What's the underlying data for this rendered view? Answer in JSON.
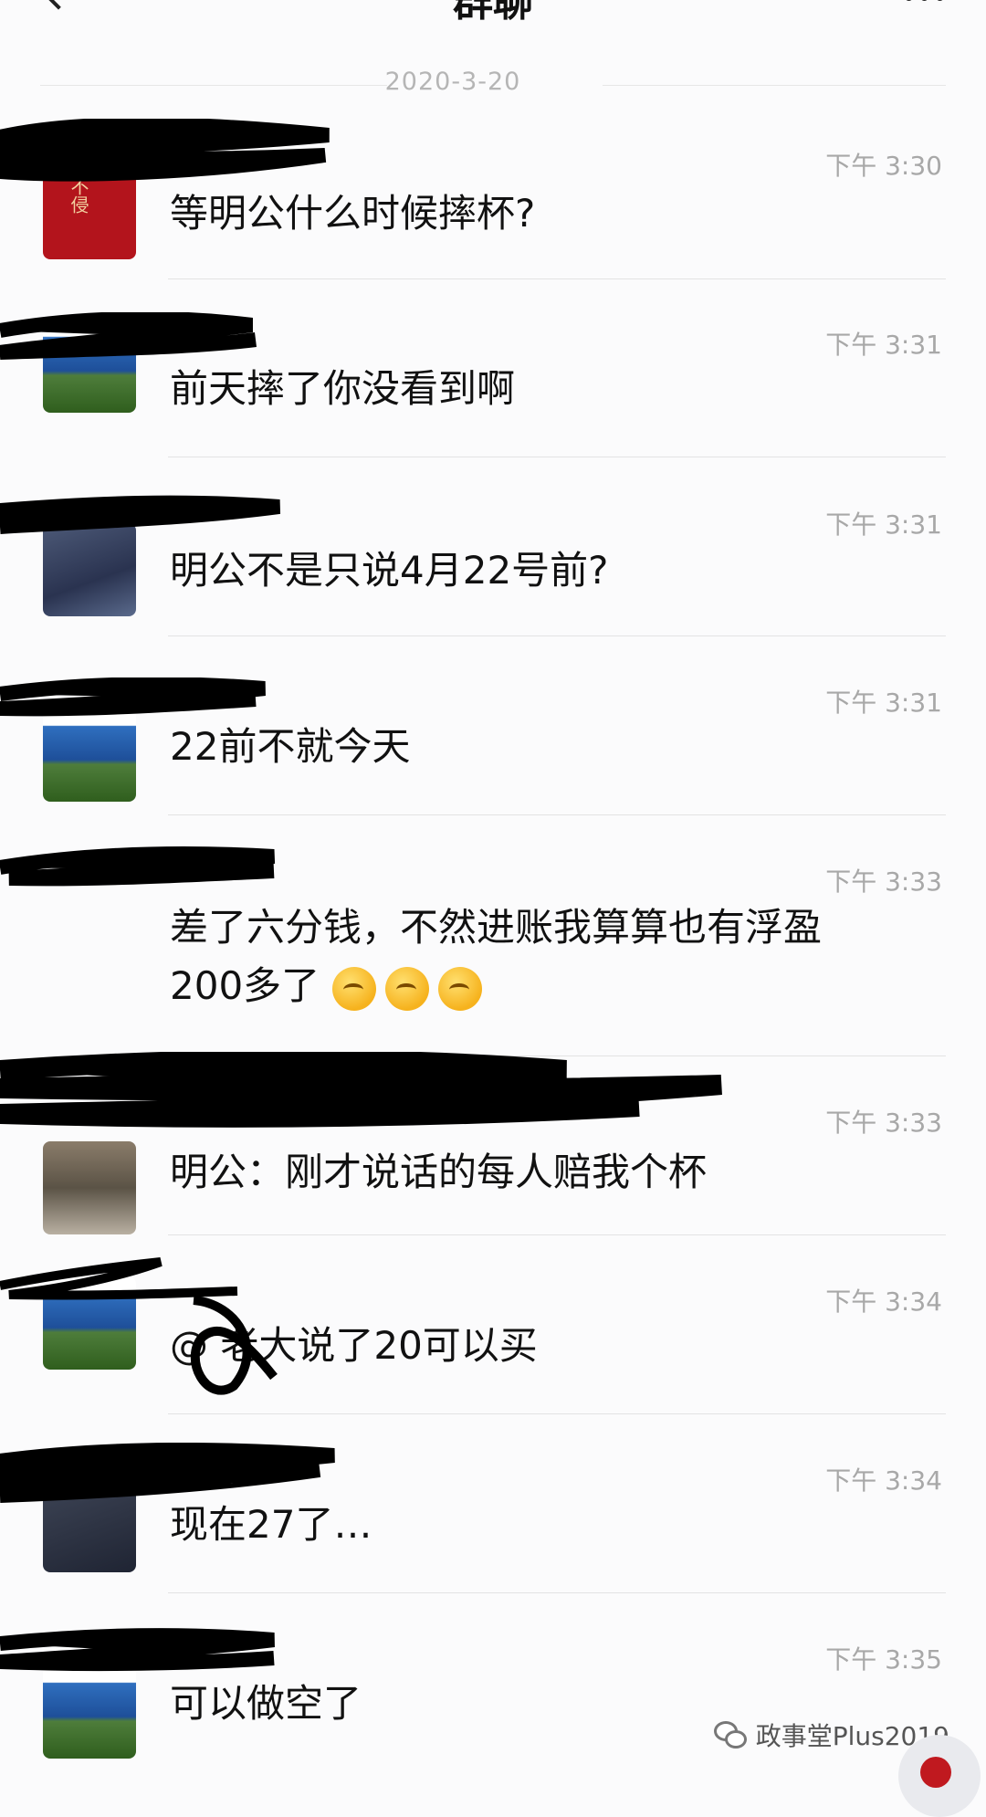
{
  "header": {
    "title": "群聊"
  },
  "date_divider": "2020-3-20",
  "messages": [
    {
      "time": "下午 3:30",
      "lines": [
        "等明公什么时候摔杯?"
      ],
      "avatar": "red-seal",
      "avatar_text": "不侵"
    },
    {
      "time": "下午 3:31",
      "lines": [
        "前天摔了你没看到啊"
      ],
      "avatar": "sea-coast"
    },
    {
      "time": "下午 3:31",
      "lines": [
        "明公不是只说4月22号前?"
      ],
      "avatar": "person"
    },
    {
      "time": "下午 3:31",
      "lines": [
        "22前不就今天"
      ],
      "avatar": "sea-coast"
    },
    {
      "time": "下午 3:33",
      "lines": [
        "差了六分钱，不然进账我算算也有浮盈",
        "200多了"
      ],
      "emoji_count": 3,
      "avatar": "none"
    },
    {
      "time": "下午 3:33",
      "lines": [
        "明公：刚才说话的每人赔我个杯"
      ],
      "avatar": "street"
    },
    {
      "time": "下午 3:34",
      "lines": [
        "@ 老大说了20可以买"
      ],
      "avatar": "sea-coast"
    },
    {
      "time": "下午 3:34",
      "lines": [
        "现在27了…"
      ],
      "avatar": "dark"
    },
    {
      "time": "下午 3:35",
      "lines": [
        "可以做空了"
      ],
      "avatar": "sea-coast"
    }
  ],
  "watermark": {
    "text": "政事堂Plus2019",
    "icon": "wechat-icon"
  },
  "colors": {
    "background": "#fbfbfc",
    "time_text": "#a8a8a8",
    "redaction": "#000000"
  }
}
